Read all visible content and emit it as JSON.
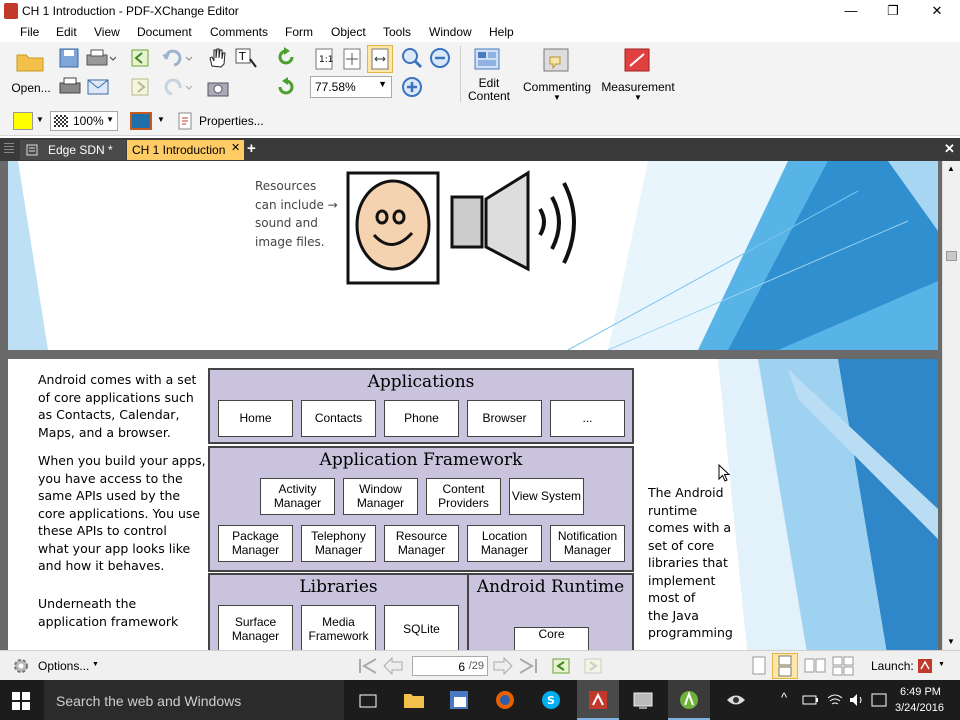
{
  "window": {
    "title": "CH 1 Introduction - PDF-XChange Editor",
    "minimize": "—",
    "maximize": "❐",
    "close": "✕"
  },
  "menu": [
    "File",
    "Edit",
    "View",
    "Document",
    "Comments",
    "Form",
    "Object",
    "Tools",
    "Window",
    "Help"
  ],
  "toolbar": {
    "open_label": "Open...",
    "zoom_value": "77.58%",
    "edit_content_label": "Edit Content",
    "commenting_label": "Commenting",
    "measurement_label": "Measurement",
    "opacity_value": "100%",
    "properties_label": "Properties..."
  },
  "tabs": [
    {
      "label": "Edge SDN *",
      "active": false
    },
    {
      "label": "CH 1 Introduction",
      "active": true
    }
  ],
  "page1": {
    "handwritten_note": [
      "Resources",
      "can include →",
      "sound and",
      "image files."
    ]
  },
  "page2": {
    "left_text_1": [
      "Android comes with a set",
      "of core applications such",
      "as Contacts, Calendar,",
      "Maps, and a browser."
    ],
    "left_text_2": [
      "When you build your apps,",
      "you have access to the",
      "same APIs used by the",
      "core applications. You use",
      "these APIs to control",
      "what your app looks like",
      "and how it behaves."
    ],
    "left_text_3": [
      "Underneath the",
      "application framework"
    ],
    "applications_title": "Applications",
    "applications": [
      "Home",
      "Contacts",
      "Phone",
      "Browser",
      "..."
    ],
    "framework_title": "Application Framework",
    "framework_row1": [
      "Activity Manager",
      "Window Manager",
      "Content Providers",
      "View System"
    ],
    "framework_row2": [
      "Package Manager",
      "Telephony Manager",
      "Resource Manager",
      "Location Manager",
      "Notification Manager"
    ],
    "libraries_title": "Libraries",
    "libraries": [
      "Surface Manager",
      "Media Framework",
      "SQLite"
    ],
    "runtime_title": "Android Runtime",
    "runtime_box": "Core",
    "right_text": [
      "The Android",
      "runtime",
      "comes with a",
      "set of core",
      "libraries that",
      "implement",
      "most of",
      "the Java",
      "programming"
    ]
  },
  "statusbar": {
    "options_label": "Options...",
    "page_current": "6",
    "page_total": "/29",
    "launch_label": "Launch:"
  },
  "taskbar": {
    "search_placeholder": "Search the web and Windows",
    "time": "6:49 PM",
    "date": "3/24/2016"
  },
  "colors": {
    "accent_tab": "#ffcc66",
    "slide_blue": "#2f8fcf",
    "toolbar_bg": "#f3f3f3",
    "taskbar_bg": "#1c1c1c"
  }
}
